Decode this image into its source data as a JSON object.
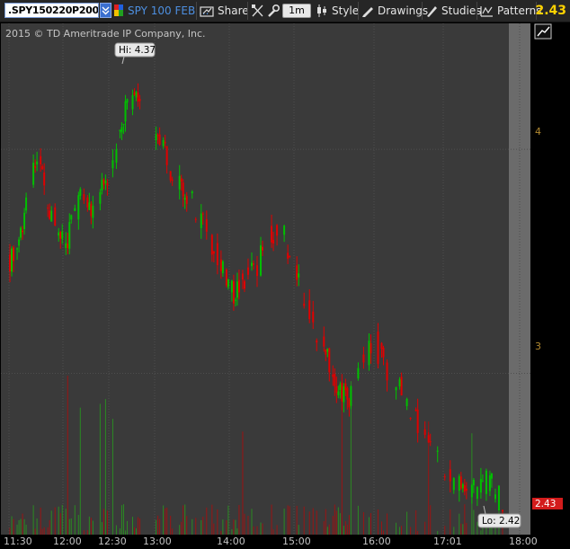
{
  "toolbar": {
    "symbol": ".SPY150220P200",
    "description": "SPY 100 FEB ...",
    "share_label": "Share",
    "aggregation_label": "1m",
    "style_label": "Style",
    "drawings_label": "Drawings",
    "studies_label": "Studies",
    "patterns_label": "Patterns",
    "last_price": "2.43"
  },
  "copyright": "2015 © TD Ameritrade IP Company, Inc.",
  "colors": {
    "up": "#00c000",
    "down": "#e00000",
    "volume_up": "#2a8a22",
    "volume_down": "#9a1414",
    "background": "#3a3a3a",
    "grid": "#4e4e4e",
    "expansion_area": "#6b6b6b",
    "price_label_bg": "#d31c1c"
  },
  "icons": {
    "chart_type": "candlestick-icon",
    "drawings": "pencil-icon",
    "studies": "flask-icon",
    "patterns": "pattern-icon",
    "maximize": "maximize-icon"
  },
  "chart_data": {
    "type": "candlestick",
    "title": "",
    "xlabel": "",
    "ylabel": "",
    "x_ticks": [
      "11:30",
      "12:00",
      "12:30",
      "13:00",
      "14:00",
      "15:00",
      "16:00",
      "17:01",
      "18:00"
    ],
    "y_ticks": [
      "4",
      "3"
    ],
    "ylim": [
      2.3,
      4.55
    ],
    "high_label": "Hi: 4.37",
    "low_label": "Lo: 2.42",
    "last_price_label": "2.43",
    "price_path": [
      3.55,
      3.5,
      3.62,
      3.88,
      3.96,
      3.78,
      3.68,
      3.55,
      3.72,
      3.8,
      3.72,
      3.78,
      3.9,
      4.05,
      4.2,
      4.3,
      4.1,
      4.0,
      4.05,
      3.92,
      3.85,
      3.78,
      3.72,
      3.68,
      3.55,
      3.48,
      3.35,
      3.4,
      3.45,
      3.5,
      3.58,
      3.65,
      3.6,
      3.45,
      3.35,
      3.25,
      3.15,
      3.05,
      2.95,
      2.88,
      3.0,
      3.08,
      3.15,
      3.05,
      2.98,
      2.92,
      2.85,
      2.78,
      2.72,
      2.62,
      2.55,
      2.52,
      2.5,
      2.45,
      2.5,
      2.52,
      2.45,
      2.43
    ]
  }
}
